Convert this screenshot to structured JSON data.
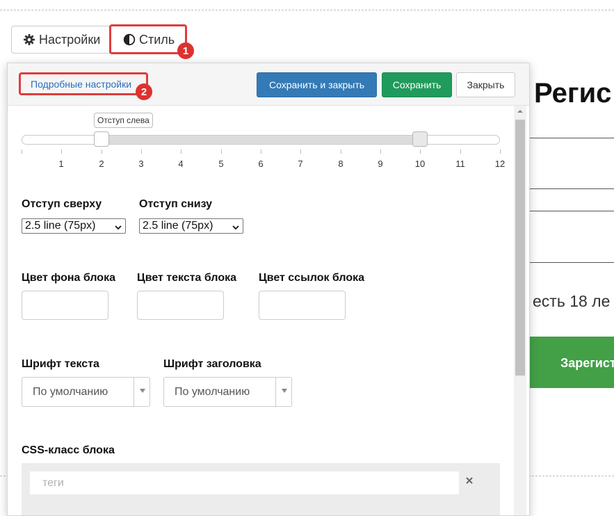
{
  "tabs": {
    "settings_label": "Настройки",
    "style_label": "Стиль",
    "settings_icon": "gear-icon",
    "style_icon": "half-circle-contrast-icon"
  },
  "callouts": {
    "one": "1",
    "two": "2",
    "color": "#dd3131"
  },
  "panel": {
    "advanced_link": "Подробные настройки",
    "save_close_label": "Сохранить и закрыть",
    "save_label": "Сохранить",
    "close_label": "Закрыть",
    "colors": {
      "primary": "#337ab7",
      "success": "#1f9b5b",
      "link": "#2a6ebb"
    }
  },
  "slider": {
    "tooltip": "Отступ слева",
    "ticks": [
      "1",
      "2",
      "3",
      "4",
      "5",
      "6",
      "7",
      "8",
      "9",
      "10",
      "11",
      "12"
    ],
    "min": 0,
    "max": 12,
    "value_left": 2,
    "value_right": 10
  },
  "spacing": {
    "top_label": "Отступ сверху",
    "top_value": "2.5 line (75px)",
    "bottom_label": "Отступ снизу",
    "bottom_value": "2.5 line (75px)"
  },
  "colors_section": {
    "bg_label": "Цвет фона блока",
    "text_label": "Цвет текста блока",
    "links_label": "Цвет ссылок блока"
  },
  "fonts": {
    "text_label": "Шрифт текста",
    "text_value": "По умолчанию",
    "heading_label": "Шрифт заголовка",
    "heading_value": "По умолчанию"
  },
  "css_class": {
    "label": "CSS-класс блока",
    "placeholder": "теги"
  },
  "background_page": {
    "title": "Регис",
    "text": "есть 18 ле",
    "button": "Зарегист",
    "button_color": "#43a047"
  }
}
